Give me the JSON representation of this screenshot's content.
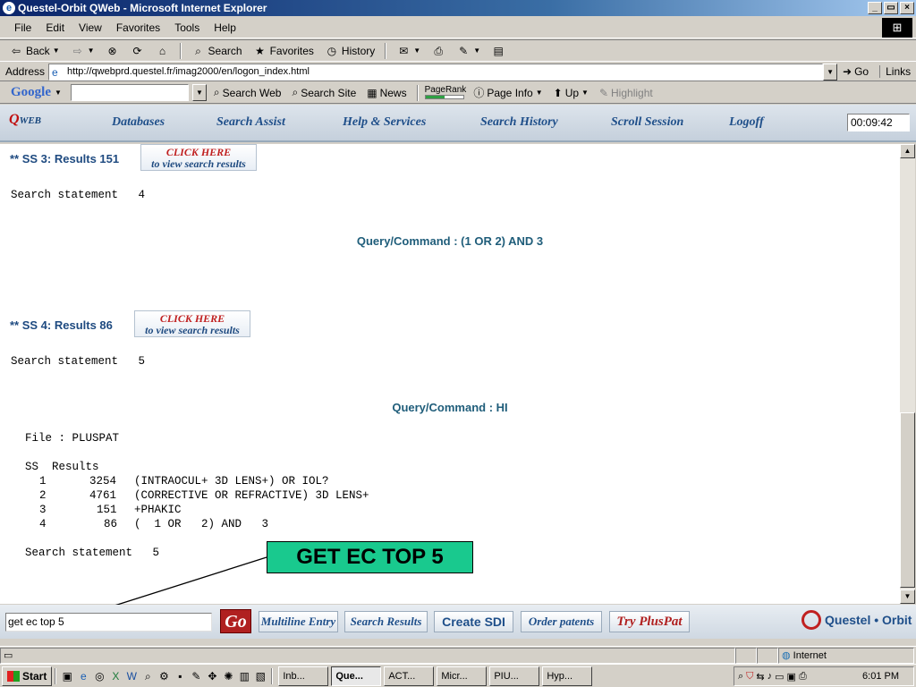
{
  "window": {
    "title": "Questel-Orbit QWeb - Microsoft Internet Explorer",
    "buttons": {
      "min": "_",
      "max": "▭",
      "close": "×"
    }
  },
  "menu": [
    "File",
    "Edit",
    "View",
    "Favorites",
    "Tools",
    "Help"
  ],
  "toolbar": {
    "back": "Back",
    "search": "Search",
    "favorites": "Favorites",
    "history": "History"
  },
  "address": {
    "label": "Address",
    "url": "http://qwebprd.questel.fr/imag2000/en/logon_index.html",
    "go": "Go",
    "links": "Links"
  },
  "googlebar": {
    "logo": "Google",
    "search_web": "Search Web",
    "search_site": "Search Site",
    "news": "News",
    "pagerank": "PageRank",
    "page_info": "Page Info",
    "up": "Up",
    "highlight": "Highlight"
  },
  "nav": {
    "logo_q": "Q",
    "logo_web": "WEB",
    "items": [
      "Databases",
      "Search Assist",
      "Help & Services",
      "Search History",
      "Scroll Session",
      "Logoff"
    ],
    "timer": "00:09:42"
  },
  "content": {
    "ss3": {
      "label": "** SS 3: Results 151",
      "click1": "CLICK HERE",
      "click2": "to view search results",
      "statement": "Search statement   4"
    },
    "query1": "Query/Command : (1 OR 2) AND 3",
    "ss4": {
      "label": "** SS 4: Results 86",
      "click1": "CLICK HERE",
      "click2": "to view search results",
      "statement": "Search statement   5"
    },
    "query2": "Query/Command : HI",
    "file": "File : PLUSPAT",
    "table_header": "SS  Results",
    "rows": [
      {
        "ss": "1",
        "results": "3254",
        "query": "(INTRAOCUL+ 3D LENS+) OR IOL?"
      },
      {
        "ss": "2",
        "results": "4761",
        "query": "(CORRECTIVE OR REFRACTIVE) 3D LENS+"
      },
      {
        "ss": "3",
        "results": "151",
        "query": "+PHAKIC"
      },
      {
        "ss": "4",
        "results": "86",
        "query": "(  1 OR   2) AND   3"
      }
    ],
    "final_statement": "Search statement   5",
    "callout": "GET EC TOP 5"
  },
  "cmdbar": {
    "input_value": "get ec top 5",
    "go": "Go",
    "multiline": "Multiline Entry",
    "search_results": "Search Results",
    "create_sdi": "Create SDI",
    "order_patents": "Order patents",
    "try_pluspat": "Try PlusPat",
    "brand": "Questel • Orbit"
  },
  "status": {
    "zone": "Internet"
  },
  "taskbar": {
    "start": "Start",
    "tasks": [
      "Inb...",
      "Que...",
      "ACT...",
      "Micr...",
      "PIU...",
      "Hyp..."
    ],
    "clock": "6:01 PM"
  },
  "colors": {
    "accent": "#1f4f8a",
    "callout": "#19c98e",
    "go": "#b02020"
  }
}
